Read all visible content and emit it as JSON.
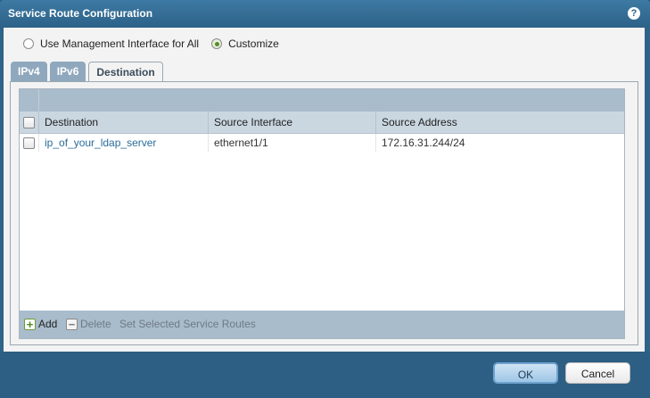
{
  "window": {
    "title": "Service Route Configuration",
    "help_glyph": "?"
  },
  "mode": {
    "options": [
      {
        "label": "Use Management Interface for All",
        "selected": false
      },
      {
        "label": "Customize",
        "selected": true
      }
    ]
  },
  "tabs": [
    {
      "label": "IPv4",
      "active": false
    },
    {
      "label": "IPv6",
      "active": false
    },
    {
      "label": "Destination",
      "active": true
    }
  ],
  "table": {
    "columns": [
      "Destination",
      "Source Interface",
      "Source Address"
    ],
    "rows": [
      {
        "destination": "ip_of_your_ldap_server",
        "source_interface": "ethernet1/1",
        "source_address": "172.16.31.244/24"
      }
    ]
  },
  "toolbar": {
    "add_label": "Add",
    "delete_label": "Delete",
    "set_selected_label": "Set Selected Service Routes"
  },
  "buttons": {
    "ok": "OK",
    "cancel": "Cancel"
  },
  "colors": {
    "title_bar": "#2d6188",
    "accent_green": "#5a8a2c",
    "link": "#2a6c9a"
  }
}
